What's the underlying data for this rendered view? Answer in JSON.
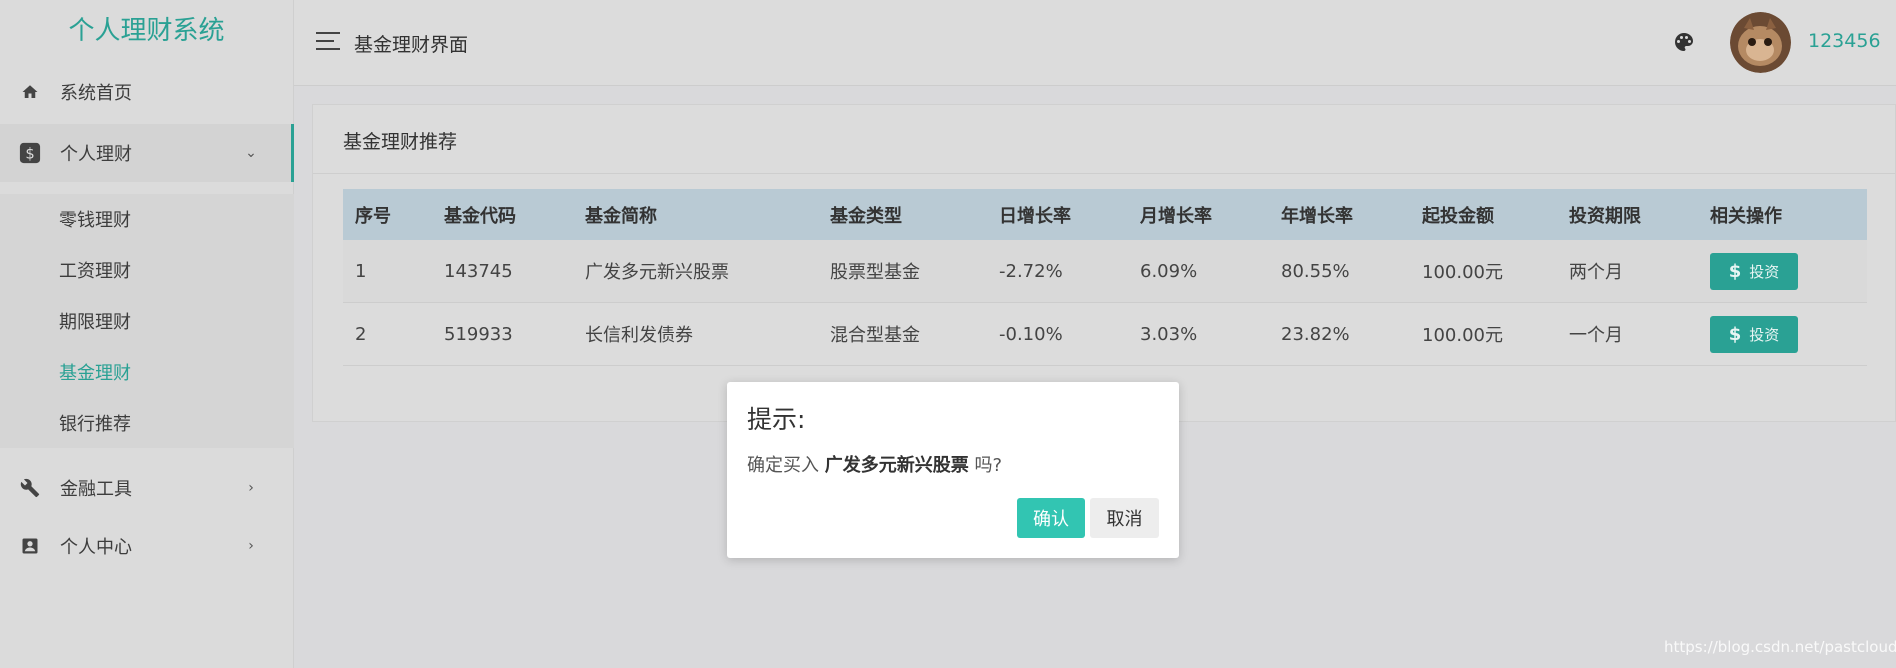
{
  "sidebar": {
    "brand": "个人理财系统",
    "items": [
      {
        "label": "系统首页",
        "icon": "home-icon"
      },
      {
        "label": "个人理财",
        "icon": "dollar-icon",
        "arrow": "⌄"
      },
      {
        "label": "金融工具",
        "icon": "wrench-icon",
        "arrow": "›"
      },
      {
        "label": "个人中心",
        "icon": "contact-icon",
        "arrow": "›"
      }
    ],
    "submenu": [
      "零钱理财",
      "工资理财",
      "期限理财",
      "基金理财",
      "银行推荐"
    ],
    "active_submenu": "基金理财"
  },
  "header": {
    "page_title": "基金理财界面",
    "username": "123456"
  },
  "card": {
    "title": "基金理财推荐",
    "columns": [
      "序号",
      "基金代码",
      "基金简称",
      "基金类型",
      "日增长率",
      "月增长率",
      "年增长率",
      "起投金额",
      "投资期限",
      "相关操作"
    ],
    "rows": [
      {
        "no": "1",
        "code": "143745",
        "name": "广发多元新兴股票",
        "type": "股票型基金",
        "daily": "-2.72%",
        "monthly": "6.09%",
        "yearly": "80.55%",
        "min": "100.00元",
        "term": "两个月",
        "action": "投资"
      },
      {
        "no": "2",
        "code": "519933",
        "name": "长信利发债券",
        "type": "混合型基金",
        "daily": "-0.10%",
        "monthly": "3.03%",
        "yearly": "23.82%",
        "min": "100.00元",
        "term": "一个月",
        "action": "投资"
      }
    ]
  },
  "modal": {
    "title": "提示:",
    "msg_prefix": "确定买入",
    "msg_fund": "广发多元新兴股票",
    "msg_suffix": "吗?",
    "ok_label": "确认",
    "cancel_label": "取消"
  },
  "watermark": "https://blog.csdn.net/pastclouds",
  "colors": {
    "accent": "#2aa194",
    "table_header": "#b9cad4",
    "ok_button": "#32c5b2"
  }
}
